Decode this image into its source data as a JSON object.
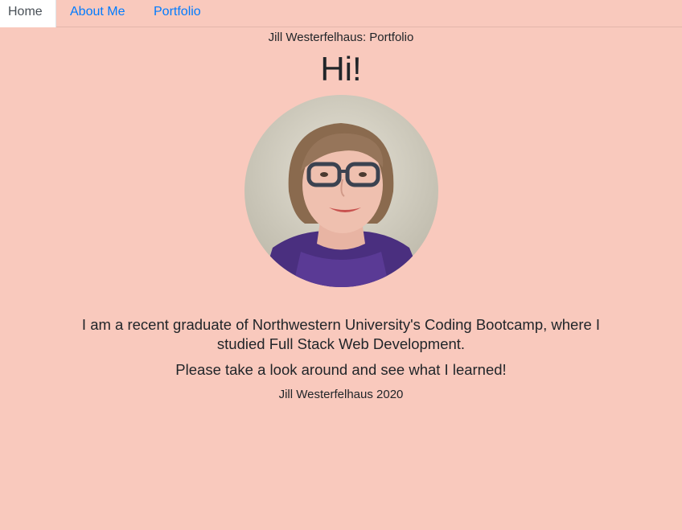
{
  "nav": {
    "tabs": [
      {
        "label": "Home",
        "active": true
      },
      {
        "label": "About Me",
        "active": false
      },
      {
        "label": "Portfolio",
        "active": false
      }
    ]
  },
  "header": {
    "subtitle": "Jill Westerfelhaus: Portfolio",
    "greeting": "Hi!"
  },
  "main": {
    "intro": "I am a recent graduate of Northwestern University's Coding Bootcamp, where I studied Full Stack Web Development.",
    "invite": "Please take a look around and see what I learned!"
  },
  "footer": {
    "text": "Jill Westerfelhaus 2020"
  },
  "colors": {
    "background": "#f9c9bd",
    "link": "#007bff",
    "text": "#212529"
  }
}
